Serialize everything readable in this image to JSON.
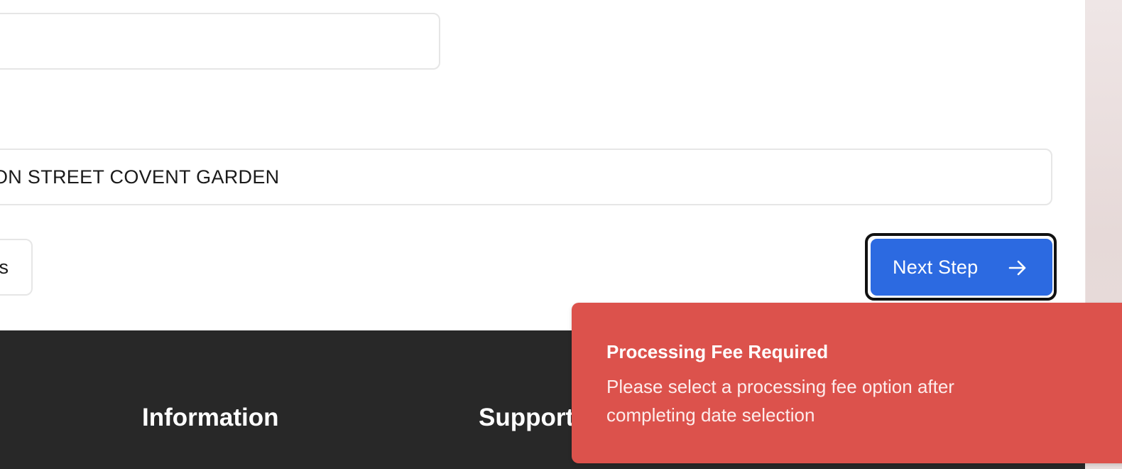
{
  "form": {
    "top_field_value": "",
    "address_value": "ON STREET COVENT GARDEN",
    "back_label": "s",
    "next_label": "Next Step",
    "next_icon": "arrow-right-icon"
  },
  "footer": {
    "headings": [
      "Information",
      "Support"
    ]
  },
  "toast": {
    "title": "Processing Fee Required",
    "message": "Please select a processing fee option after completing date selection"
  },
  "colors": {
    "primary": "#2c6ae1",
    "error": "#dc524c",
    "footer_bg": "#282828"
  }
}
